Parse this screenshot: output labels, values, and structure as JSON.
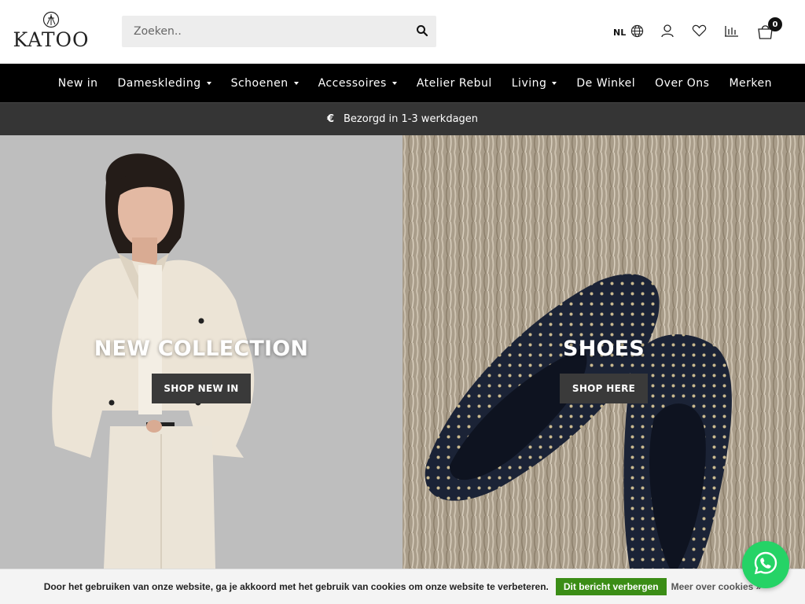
{
  "header": {
    "logo_text": "KATOO",
    "search_placeholder": "Zoeken..",
    "language": "NL",
    "cart_count": "0"
  },
  "nav": {
    "items": [
      {
        "label": "New in",
        "dropdown": false
      },
      {
        "label": "Dameskleding",
        "dropdown": true
      },
      {
        "label": "Schoenen",
        "dropdown": true
      },
      {
        "label": "Accessoires",
        "dropdown": true
      },
      {
        "label": "Atelier Rebul",
        "dropdown": false
      },
      {
        "label": "Living",
        "dropdown": true
      },
      {
        "label": "De Winkel",
        "dropdown": false
      },
      {
        "label": "Over Ons",
        "dropdown": false
      },
      {
        "label": "Merken",
        "dropdown": false
      }
    ]
  },
  "usp": {
    "icon": "€",
    "text": "Bezorgd in 1-3 werkdagen"
  },
  "hero": {
    "left": {
      "title": "NEW COLLECTION",
      "button": "SHOP NEW IN"
    },
    "right": {
      "title": "SHOES",
      "button": "SHOP HERE"
    }
  },
  "cookie": {
    "text": "Door het gebruiken van onze website, ga je akkoord met het gebruik van cookies om onze website te verbeteren.",
    "button": "Dit bericht verbergen",
    "link": "Meer over cookies »"
  },
  "colors": {
    "nav_bg": "#000000",
    "usp_bg": "#353535",
    "cookie_button": "#3b8d16",
    "whatsapp": "#25d366"
  },
  "icons": [
    "search-icon",
    "globe-icon",
    "user-icon",
    "heart-icon",
    "compare-icon",
    "cart-icon",
    "whatsapp-icon"
  ]
}
